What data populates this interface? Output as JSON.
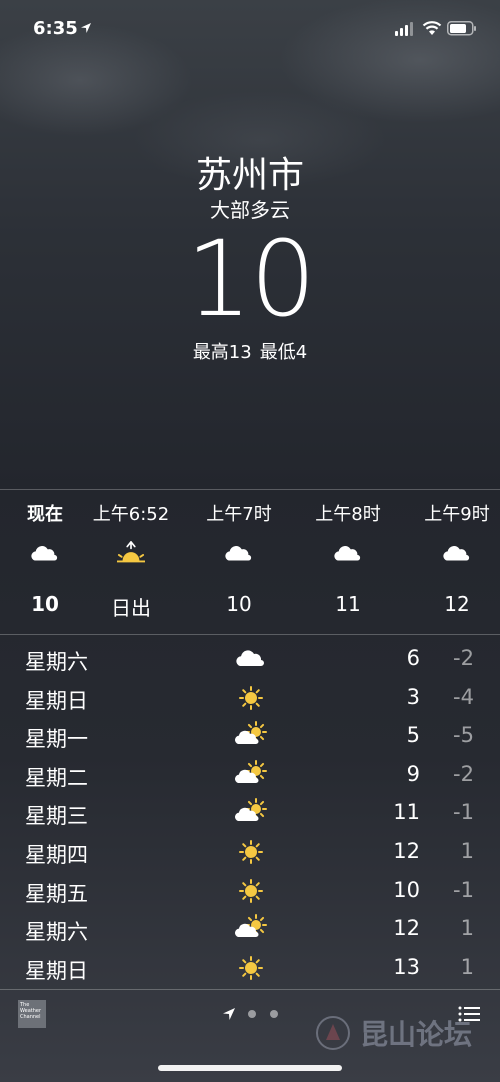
{
  "status_bar": {
    "time": "6:35",
    "icons": [
      "location-arrow-icon",
      "signal-icon",
      "wifi-icon",
      "battery-icon"
    ]
  },
  "weather": {
    "city": "苏州市",
    "condition": "大部多云",
    "temperature": "10",
    "high_label": "最高13",
    "low_label": "最低4"
  },
  "hourly": [
    {
      "label": "现在",
      "icon": "cloud-icon",
      "value": "10",
      "bold": true
    },
    {
      "label": "上午6:52",
      "icon": "sunrise-icon",
      "value": "日出",
      "bold": false
    },
    {
      "label": "上午7时",
      "icon": "cloud-icon",
      "value": "10",
      "bold": false
    },
    {
      "label": "上午8时",
      "icon": "cloud-icon",
      "value": "11",
      "bold": false
    },
    {
      "label": "上午9时",
      "icon": "cloud-icon",
      "value": "12",
      "bold": false
    }
  ],
  "daily": [
    {
      "day": "星期六",
      "icon": "cloud-icon",
      "high": "6",
      "low": "-2"
    },
    {
      "day": "星期日",
      "icon": "sun-icon",
      "high": "3",
      "low": "-4"
    },
    {
      "day": "星期一",
      "icon": "partly-cloudy-icon",
      "high": "5",
      "low": "-5"
    },
    {
      "day": "星期二",
      "icon": "partly-cloudy-icon",
      "high": "9",
      "low": "-2"
    },
    {
      "day": "星期三",
      "icon": "partly-cloudy-icon",
      "high": "11",
      "low": "-1"
    },
    {
      "day": "星期四",
      "icon": "sun-icon",
      "high": "12",
      "low": "1"
    },
    {
      "day": "星期五",
      "icon": "sun-icon",
      "high": "10",
      "low": "-1"
    },
    {
      "day": "星期六",
      "icon": "partly-cloudy-icon",
      "high": "12",
      "low": "1"
    },
    {
      "day": "星期日",
      "icon": "sun-icon",
      "high": "13",
      "low": "1"
    }
  ],
  "bottom_bar": {
    "logo_line1": "The",
    "logo_line2": "Weather",
    "logo_line3": "Channel",
    "watermark": "昆山论坛"
  },
  "colors": {
    "sun": "#f5c842",
    "cloud": "#ffffff",
    "low_temp_text": "#9a9ca1"
  }
}
